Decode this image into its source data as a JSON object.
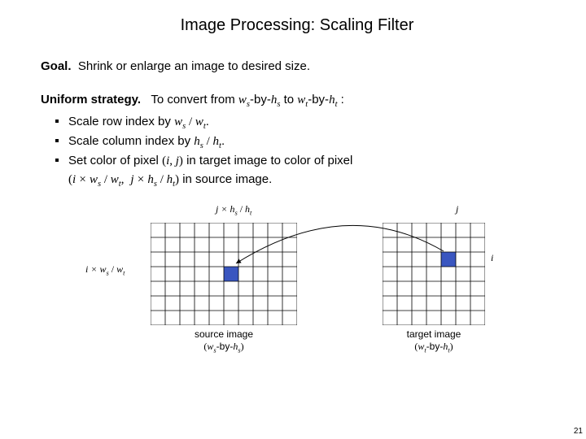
{
  "title": "Image Processing:  Scaling Filter",
  "goal_label": "Goal.",
  "goal_text": "Shrink or enlarge an image to desired size.",
  "strategy_label": "Uniform strategy.",
  "strategy_text_a": "To convert from ",
  "strategy_text_b": "-by-",
  "strategy_text_c": " to ",
  "strategy_text_d": "-by-",
  "strategy_text_e": " :",
  "bullet1_a": "Scale row index by ",
  "bullet1_b": " / ",
  "bullet1_c": ".",
  "bullet2_a": "Scale column index by ",
  "bullet2_b": " / ",
  "bullet2_c": ".",
  "bullet3_a": "Set color of pixel ",
  "bullet3_b": " in target image to color of pixel",
  "bullet3_c": " in source image.",
  "sym": {
    "ws": "w",
    "ws_sub": "s",
    "hs": "h",
    "hs_sub": "s",
    "wt": "w",
    "wt_sub": "t",
    "ht": "h",
    "ht_sub": "t",
    "i": "i",
    "j": "j",
    "times": "×",
    "lp": "(",
    "rp": ")",
    "comma": ", "
  },
  "labels": {
    "i_expr_a": "i × ",
    "i_expr_b": " / ",
    "j_expr_a": "j × ",
    "j_expr_b": " / ",
    "j": "j",
    "i": "i"
  },
  "captions": {
    "source_a": "source image",
    "source_b_pre": "(",
    "source_b_mid": "-by-",
    "source_b_post": ")",
    "target_a": "target image",
    "target_b_pre": "(",
    "target_b_mid": "-by-",
    "target_b_post": ")"
  },
  "chart_data": {
    "type": "table",
    "source_grid": {
      "cols": 10,
      "rows": 7,
      "filled_cell": {
        "col": 5,
        "row": 3
      }
    },
    "target_grid": {
      "cols": 7,
      "rows": 7,
      "filled_cell": {
        "col": 4,
        "row": 2
      }
    },
    "fill_color": "#3a56c0"
  },
  "page_number": "21"
}
